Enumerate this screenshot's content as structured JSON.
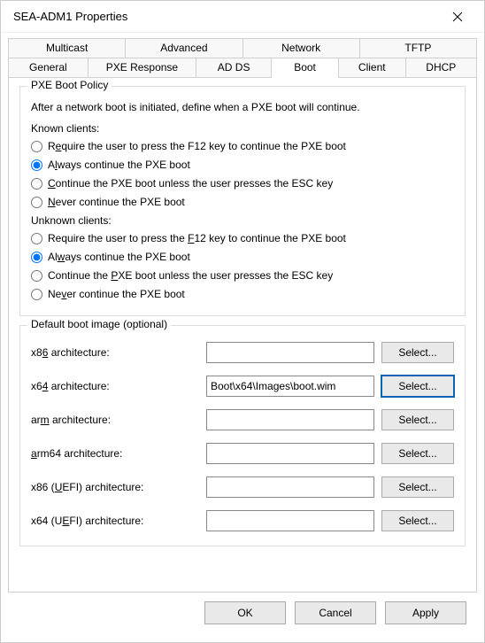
{
  "window": {
    "title": "SEA-ADM1 Properties"
  },
  "tabs": {
    "row1": [
      "Multicast",
      "Advanced",
      "Network",
      "TFTP"
    ],
    "row2": [
      "General",
      "PXE Response",
      "AD DS",
      "Boot",
      "Client",
      "DHCP"
    ],
    "active": "Boot"
  },
  "policy": {
    "groupTitle": "PXE Boot Policy",
    "description": "After a network boot is initiated, define when a PXE boot will continue.",
    "knownLabel": "Known clients:",
    "unknownLabel": "Unknown clients:",
    "options": {
      "require_pre": "R",
      "require_u": "e",
      "require_post": "quire the user to press the F12 key to continue the PXE boot",
      "always_pre": "A",
      "always_u": "l",
      "always_post": "ways continue the PXE boot",
      "unless_pre": "",
      "unless_u": "C",
      "unless_post": "ontinue the PXE boot unless the user presses the ESC key",
      "never_pre": "",
      "never_u": "N",
      "never_post": "ever continue the PXE boot",
      "u_require_pre": "Require the user to press the ",
      "u_require_u": "F",
      "u_require_post": "12 key to continue the PXE boot",
      "u_always_pre": "Al",
      "u_always_u": "w",
      "u_always_post": "ays continue the PXE boot",
      "u_unless_pre": "Continue the ",
      "u_unless_u": "P",
      "u_unless_post": "XE boot unless the user presses the ESC key",
      "u_never_pre": "Ne",
      "u_never_u": "v",
      "u_never_post": "er continue the PXE boot"
    },
    "knownSelected": "always",
    "unknownSelected": "always"
  },
  "defaultBoot": {
    "groupTitle": "Default boot image (optional)",
    "selectLabel": "Select...",
    "rows": [
      {
        "label_pre": "x8",
        "label_u": "6",
        "label_post": " architecture:",
        "value": ""
      },
      {
        "label_pre": "x6",
        "label_u": "4",
        "label_post": " architecture:",
        "value": "Boot\\x64\\Images\\boot.wim"
      },
      {
        "label_pre": "ar",
        "label_u": "m",
        "label_post": " architecture:",
        "value": ""
      },
      {
        "label_pre": "",
        "label_u": "a",
        "label_post": "rm64 architecture:",
        "value": ""
      },
      {
        "label_pre": "x86 (",
        "label_u": "U",
        "label_post": "EFI) architecture:",
        "value": ""
      },
      {
        "label_pre": "x64 (U",
        "label_u": "E",
        "label_post": "FI) architecture:",
        "value": ""
      }
    ],
    "focusedRow": 1
  },
  "footer": {
    "ok": "OK",
    "cancel": "Cancel",
    "apply": "Apply"
  }
}
